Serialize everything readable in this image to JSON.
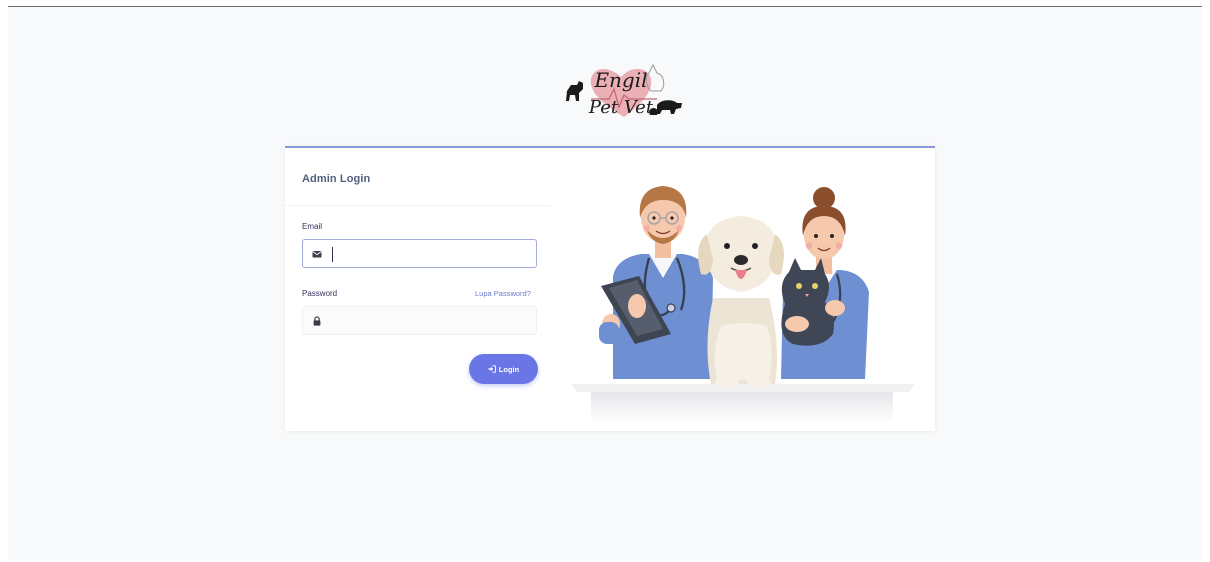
{
  "logo": {
    "line1": "Engil",
    "line2": "Pet Vet"
  },
  "login_card": {
    "title": "Admin Login",
    "email_label": "Email",
    "email_value": "",
    "password_label": "Password",
    "password_value": "",
    "forgot_link": "Lupa Password?",
    "login_button": "Login"
  },
  "icons": {
    "email": "envelope-icon",
    "password": "lock-icon",
    "login": "sign-in-icon"
  },
  "colors": {
    "accent": "#6b76e6",
    "card_top_border": "#8a97d6",
    "link": "#6a7ad0",
    "scrub_blue": "#6f8fd3"
  }
}
